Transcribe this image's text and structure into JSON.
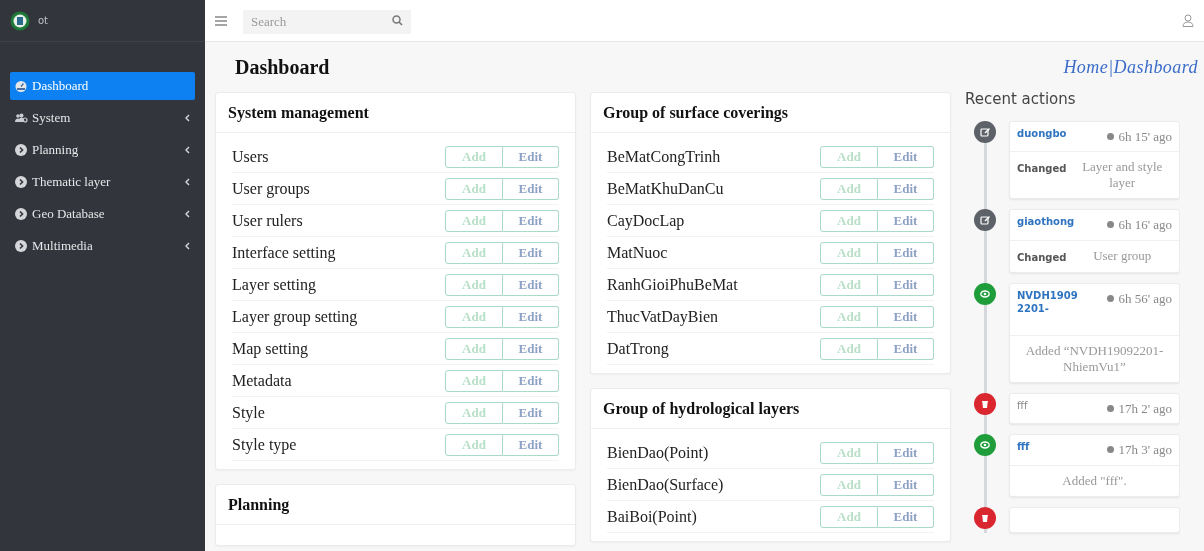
{
  "brand": {
    "name": "ot"
  },
  "sidebar": {
    "items": [
      {
        "label": "Dashboard",
        "kind": "gauge",
        "selected": true,
        "has_submenu": false
      },
      {
        "label": "System",
        "kind": "users",
        "selected": false,
        "has_submenu": true
      },
      {
        "label": "Planning",
        "kind": "chevron",
        "selected": false,
        "has_submenu": true
      },
      {
        "label": "Thematic layer",
        "kind": "chevron",
        "selected": false,
        "has_submenu": true
      },
      {
        "label": "Geo Database",
        "kind": "chevron",
        "selected": false,
        "has_submenu": true
      },
      {
        "label": "Multimedia",
        "kind": "chevron",
        "selected": false,
        "has_submenu": true
      }
    ]
  },
  "search": {
    "placeholder": "Search"
  },
  "page": {
    "title": "Dashboard",
    "breadcrumb": "Home|Dashboard"
  },
  "columns": [
    [
      {
        "title": "System management",
        "rows": [
          {
            "label": "Users",
            "add": "Add",
            "edit": "Edit"
          },
          {
            "label": "User groups",
            "add": "Add",
            "edit": "Edit"
          },
          {
            "label": "User rulers",
            "add": "Add",
            "edit": "Edit"
          },
          {
            "label": "Interface setting",
            "add": "Add",
            "edit": "Edit"
          },
          {
            "label": "Layer setting",
            "add": "Add",
            "edit": "Edit"
          },
          {
            "label": "Layer group setting",
            "add": "Add",
            "edit": "Edit"
          },
          {
            "label": "Map setting",
            "add": "Add",
            "edit": "Edit"
          },
          {
            "label": "Metadata",
            "add": "Add",
            "edit": "Edit"
          },
          {
            "label": "Style",
            "add": "Add",
            "edit": "Edit"
          },
          {
            "label": "Style type",
            "add": "Add",
            "edit": "Edit"
          }
        ]
      },
      {
        "title": "Planning"
      }
    ],
    [
      {
        "title": "Group of surface coverings",
        "rows": [
          {
            "label": "BeMatCongTrinh",
            "add": "Add",
            "edit": "Edit"
          },
          {
            "label": "BeMatKhuDanCu",
            "add": "Add",
            "edit": "Edit"
          },
          {
            "label": "CayDocLap",
            "add": "Add",
            "edit": "Edit"
          },
          {
            "label": "MatNuoc",
            "add": "Add",
            "edit": "Edit"
          },
          {
            "label": "RanhGioiPhuBeMat",
            "add": "Add",
            "edit": "Edit"
          },
          {
            "label": "ThucVatDayBien",
            "add": "Add",
            "edit": "Edit"
          },
          {
            "label": "DatTrong",
            "add": "Add",
            "edit": "Edit"
          }
        ]
      },
      {
        "title": "Group of hydrological layers",
        "rows": [
          {
            "label": "BienDao(Point)",
            "add": "Add",
            "edit": "Edit"
          },
          {
            "label": "BienDao(Surface)",
            "add": "Add",
            "edit": "Edit"
          },
          {
            "label": "BaiBoi(Point)",
            "add": "Add",
            "edit": "Edit"
          }
        ]
      }
    ]
  ],
  "recent_actions": {
    "title": "Recent actions",
    "items": [
      {
        "kind": "edit",
        "user": "duongbo",
        "linked": true,
        "time": "6h 15' ago",
        "verb": "Changed",
        "detail": "Layer and style layer"
      },
      {
        "kind": "edit",
        "user": "giaothong",
        "linked": true,
        "time": "6h 16' ago",
        "verb": "Changed",
        "detail": "User group"
      },
      {
        "kind": "add",
        "user": "NVDH1909 2201-",
        "linked": true,
        "time": "6h 56' ago",
        "detail": "Added “NVDH19092201-NhiemVu1”"
      },
      {
        "kind": "delete",
        "user": "fff",
        "linked": false,
        "time": "17h 2' ago"
      },
      {
        "kind": "add",
        "user": "fff",
        "linked": true,
        "time": "17h 3' ago",
        "detail": "Added \"fff\"."
      },
      {
        "kind": "delete"
      }
    ]
  }
}
